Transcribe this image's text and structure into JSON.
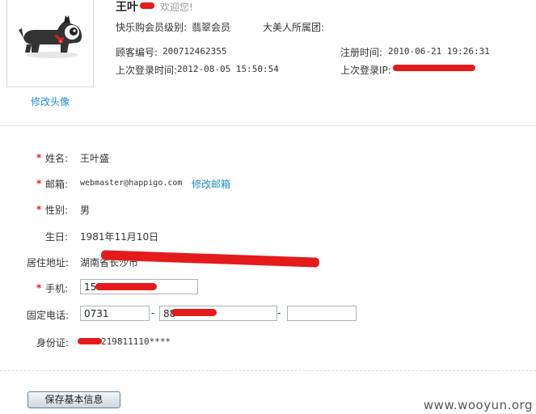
{
  "header": {
    "username": "王叶",
    "welcome": "欢迎您!",
    "member_level_label": "快乐购会员级别:",
    "member_level_value": "翡翠会员",
    "group_label": "大美人所属团:",
    "customer_no_label": "顾客编号:",
    "customer_no_value": "200712462355",
    "register_time_label": "注册时间:",
    "register_time_value": "2010-06-21 19:26:31",
    "last_login_time_label": "上次登录时间:",
    "last_login_time_value": "2012-08-05 15:50:54",
    "last_login_ip_label": "上次登录IP:"
  },
  "avatar": {
    "edit_label": "修改头像",
    "icon": "scottie-dog-icon"
  },
  "form": {
    "name_label": "姓名:",
    "name_value": "王叶盛",
    "email_label": "邮箱:",
    "email_value": "webmaster@happigo.com",
    "edit_email_label": "修改邮箱",
    "gender_label": "性别:",
    "gender_value": "男",
    "birthday_label": "生日:",
    "birthday_value": "1981年11月10日",
    "address_label": "居住地址:",
    "address_value": "湖南省长沙市",
    "mobile_label": "手机:",
    "mobile_value": "158",
    "phone_label": "固定电话:",
    "phone_area_value": "0731",
    "phone_number_value": "88",
    "phone_ext_value": "",
    "id_label": "身份证:",
    "id_value": "219811110****",
    "dash": "-",
    "required_mark": "*"
  },
  "actions": {
    "save_label": "保存基本信息"
  },
  "watermark": "www.wooyun.org",
  "colors": {
    "link": "#1a8fc9",
    "required": "#e0231d",
    "redaction": "#e41b1b"
  }
}
